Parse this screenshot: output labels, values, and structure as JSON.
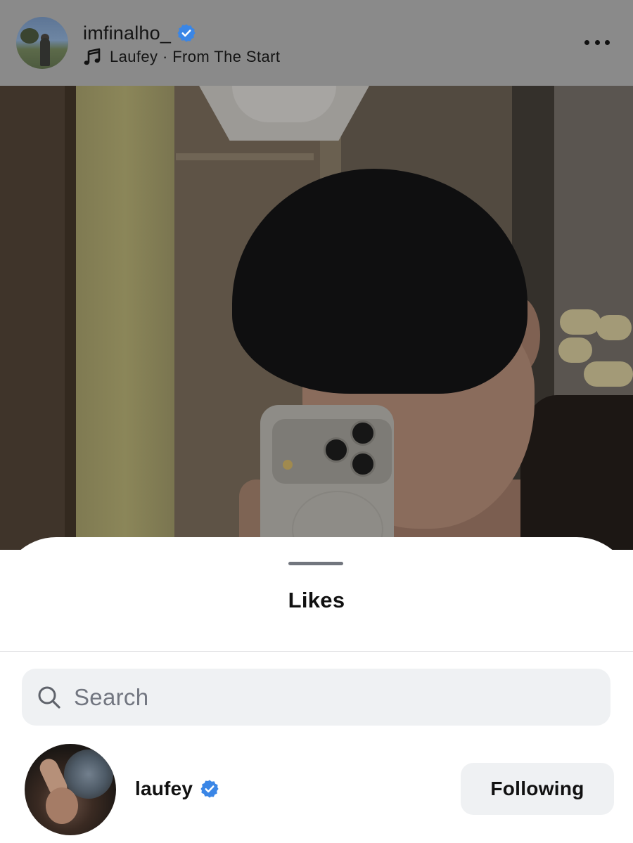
{
  "post": {
    "username": "imfinalho_",
    "verified": true,
    "music": "Laufey · From The Start"
  },
  "likes_sheet": {
    "title": "Likes",
    "search": {
      "placeholder": "Search"
    },
    "users": [
      {
        "username": "laufey",
        "verified": true,
        "button_label": "Following"
      }
    ]
  },
  "icons": {
    "verified": "verified-badge-icon",
    "music": "music-note-icon",
    "more": "more-horizontal-icon",
    "search": "search-icon"
  },
  "colors": {
    "verified_blue": "#3a86e6",
    "button_bg": "#eff1f3",
    "overlay_header": "#8a8a8a"
  }
}
